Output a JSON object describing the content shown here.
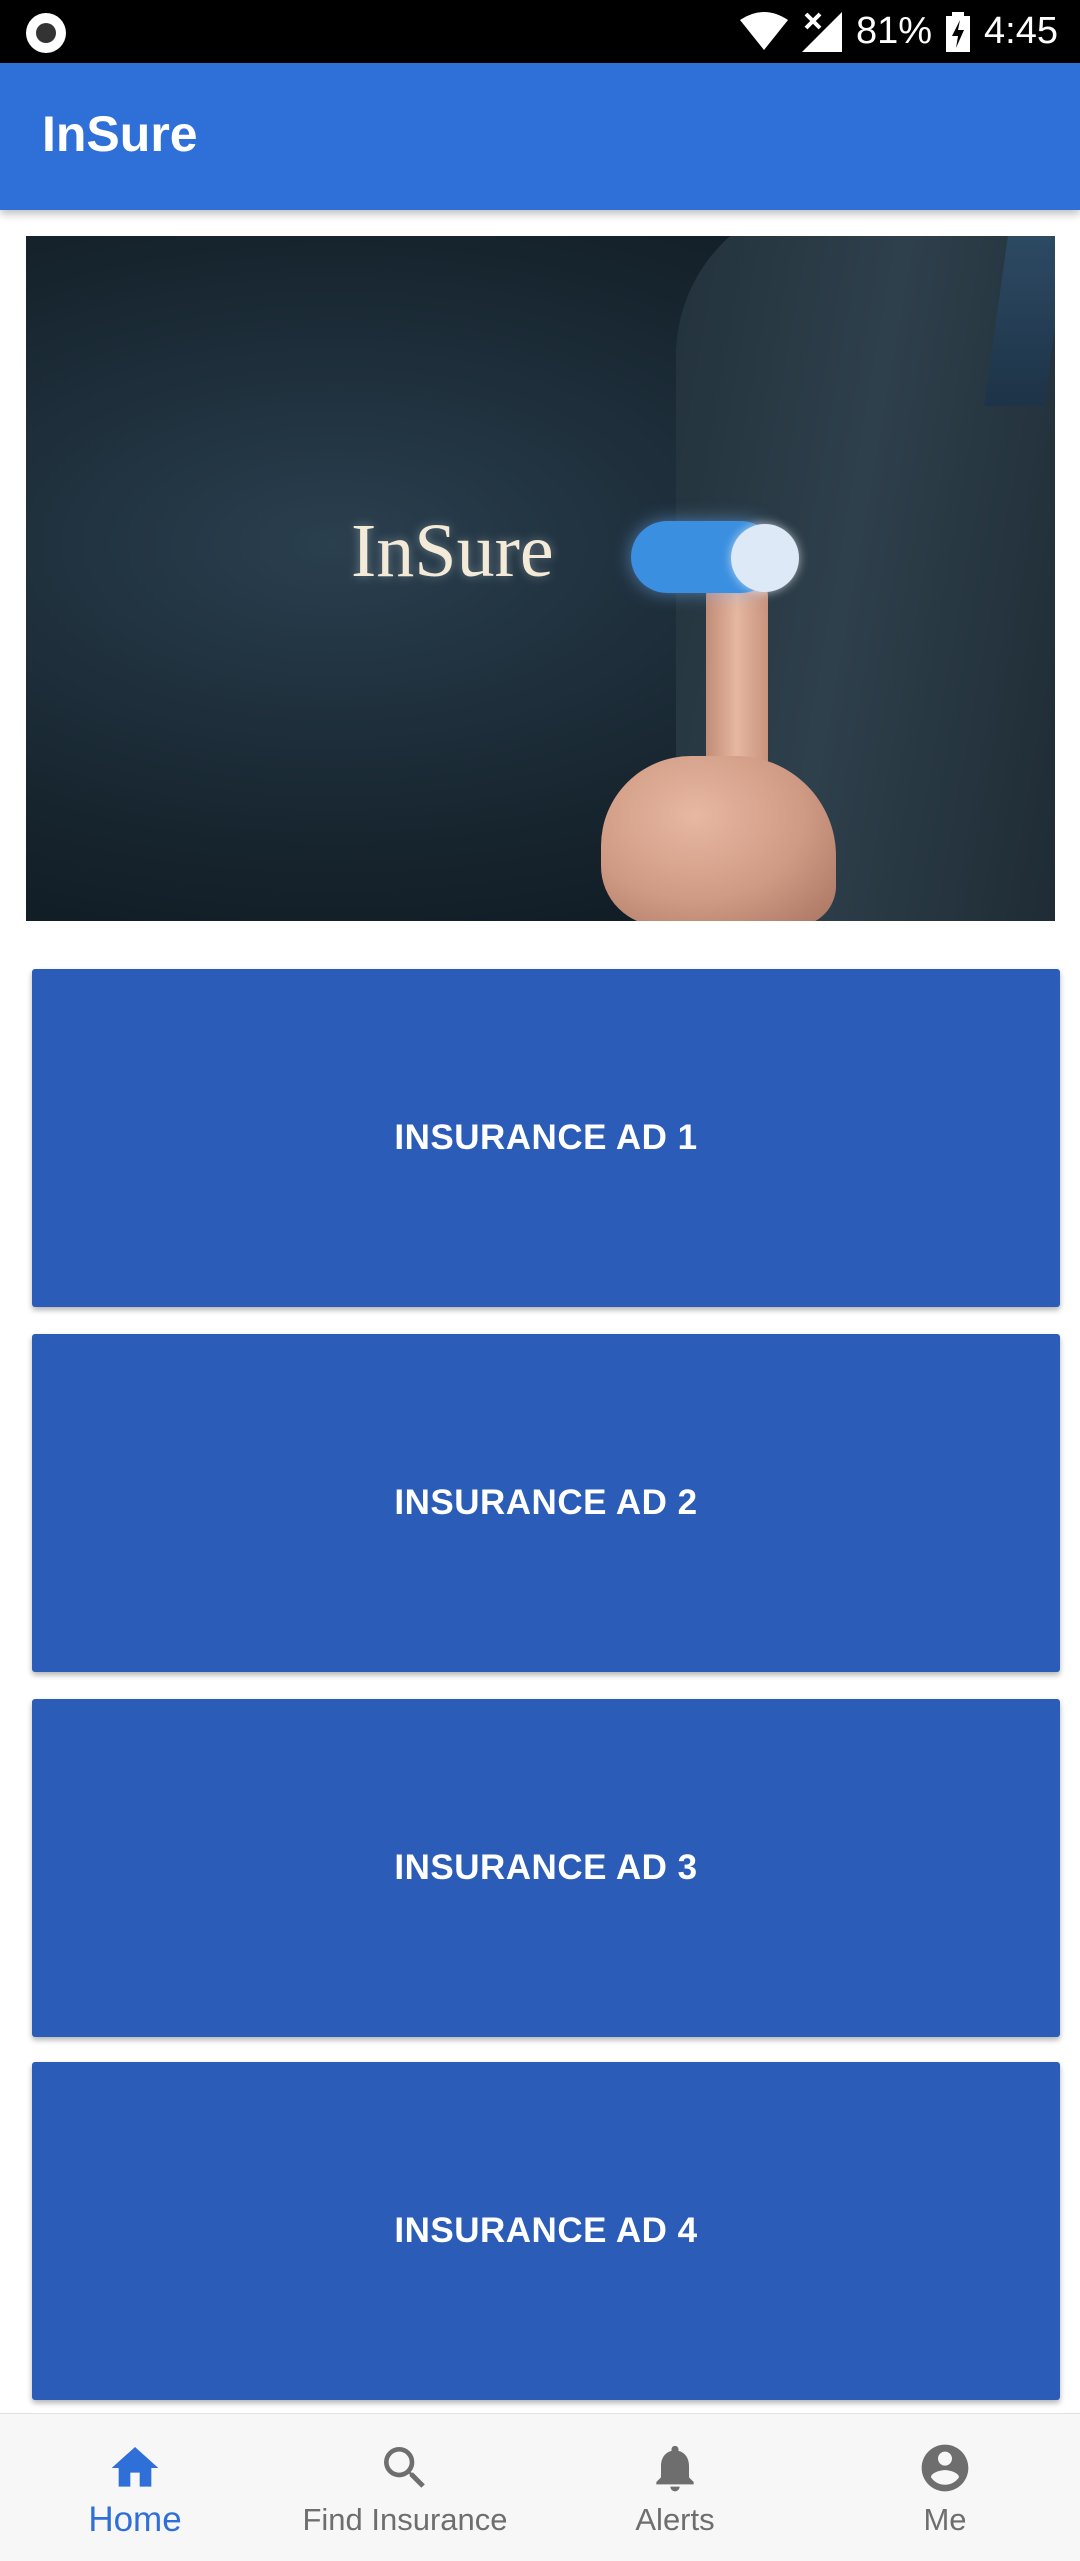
{
  "status_bar": {
    "battery": "81%",
    "time": "4:45"
  },
  "app": {
    "title": "InSure"
  },
  "hero": {
    "logo_text": "InSure"
  },
  "ads": [
    {
      "label": "INSURANCE AD 1"
    },
    {
      "label": "INSURANCE AD 2"
    },
    {
      "label": "INSURANCE AD 3"
    },
    {
      "label": "INSURANCE AD 4"
    }
  ],
  "bottom_nav": {
    "items": [
      {
        "label": "Home",
        "icon": "home-icon",
        "active": true
      },
      {
        "label": "Find Insurance",
        "icon": "search-icon",
        "active": false
      },
      {
        "label": "Alerts",
        "icon": "bell-icon",
        "active": false
      },
      {
        "label": "Me",
        "icon": "account-icon",
        "active": false
      }
    ]
  },
  "colors": {
    "primary": "#2f6fd8",
    "ad_card": "#2b5db8",
    "nav_inactive": "#6e6e6e"
  }
}
